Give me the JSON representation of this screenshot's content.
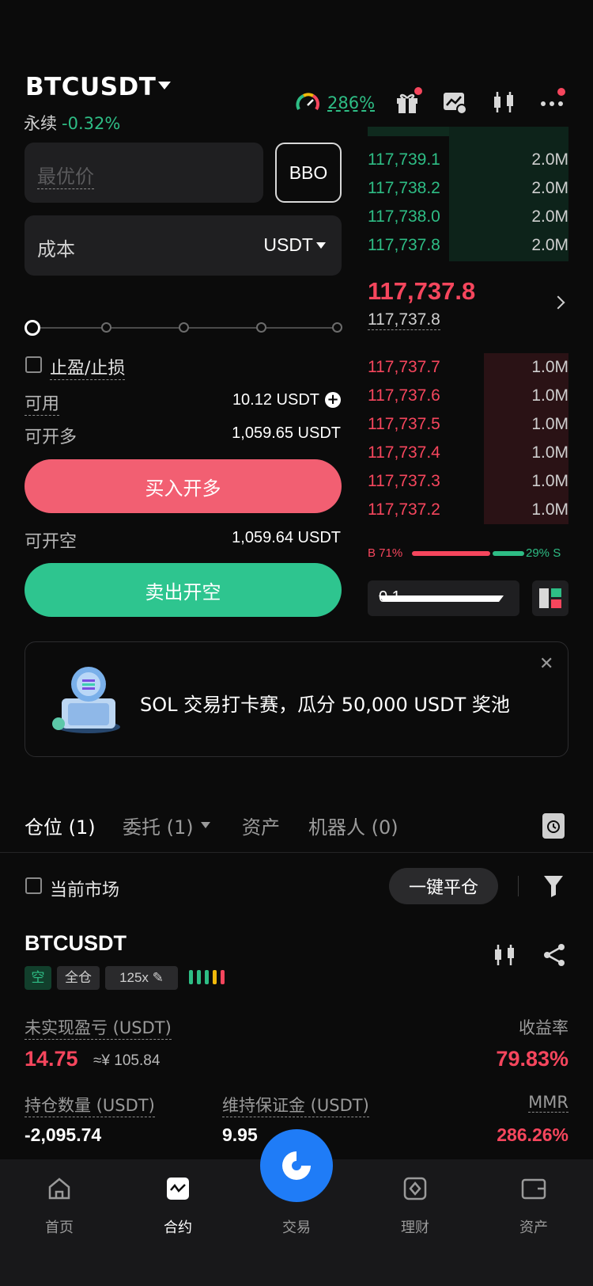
{
  "header": {
    "symbol": "BTCUSDT",
    "contract_type": "永续",
    "change_pct": "-0.32%",
    "gauge_value": "286%"
  },
  "order_form": {
    "price_placeholder": "最优价",
    "bbo_label": "BBO",
    "cost_label": "成本",
    "cost_unit": "USDT",
    "tpsl_label": "止盈/止损",
    "available_label": "可用",
    "available_value": "10.12 USDT",
    "max_long_label": "可开多",
    "max_long_value": "1,059.65 USDT",
    "buy_button": "买入开多",
    "max_short_label": "可开空",
    "max_short_value": "1,059.64 USDT",
    "sell_button": "卖出开空"
  },
  "orderbook": {
    "bids_top": [
      {
        "price": "117,739.1",
        "qty": "2.0M"
      },
      {
        "price": "117,738.2",
        "qty": "2.0M"
      },
      {
        "price": "117,738.0",
        "qty": "2.0M"
      },
      {
        "price": "117,737.8",
        "qty": "2.0M"
      }
    ],
    "last_price": "117,737.8",
    "mark_price": "117,737.8",
    "asks": [
      {
        "price": "117,737.7",
        "qty": "1.0M"
      },
      {
        "price": "117,737.6",
        "qty": "1.0M"
      },
      {
        "price": "117,737.5",
        "qty": "1.0M"
      },
      {
        "price": "117,737.4",
        "qty": "1.0M"
      },
      {
        "price": "117,737.3",
        "qty": "1.0M"
      },
      {
        "price": "117,737.2",
        "qty": "1.0M"
      }
    ],
    "buy_ratio": "B 71%",
    "sell_ratio": "29% S",
    "buy_ratio_fraction": 0.71,
    "precision": "0.1"
  },
  "banner": {
    "text": "SOL 交易打卡赛，瓜分 50,000 USDT 奖池"
  },
  "tabs": {
    "positions": "仓位 (1)",
    "orders": "委托 (1)",
    "assets": "资产",
    "bots": "机器人 (0)"
  },
  "filters": {
    "current_market": "当前市场",
    "close_all": "一键平仓"
  },
  "position": {
    "symbol": "BTCUSDT",
    "side": "空",
    "margin_mode": "全仓",
    "leverage": "125x",
    "unrealized_pnl_label": "未实现盈亏 (USDT)",
    "unrealized_pnl": "14.75",
    "unrealized_pnl_cny": "≈¥ 105.84",
    "roe_label": "收益率",
    "roe": "79.83%",
    "size_label": "持仓数量 (USDT)",
    "size": "-2,095.74",
    "maint_margin_label": "维持保证金 (USDT)",
    "maint_margin": "9.95",
    "mmr_label": "MMR",
    "mmr": "286.26%"
  },
  "nav": {
    "home": "首页",
    "futures": "合约",
    "trade": "交易",
    "earn": "理财",
    "assets": "资产"
  },
  "colors": {
    "buy": "#2ebd85",
    "sell": "#f6465d",
    "accent": "#1f7cf7"
  }
}
